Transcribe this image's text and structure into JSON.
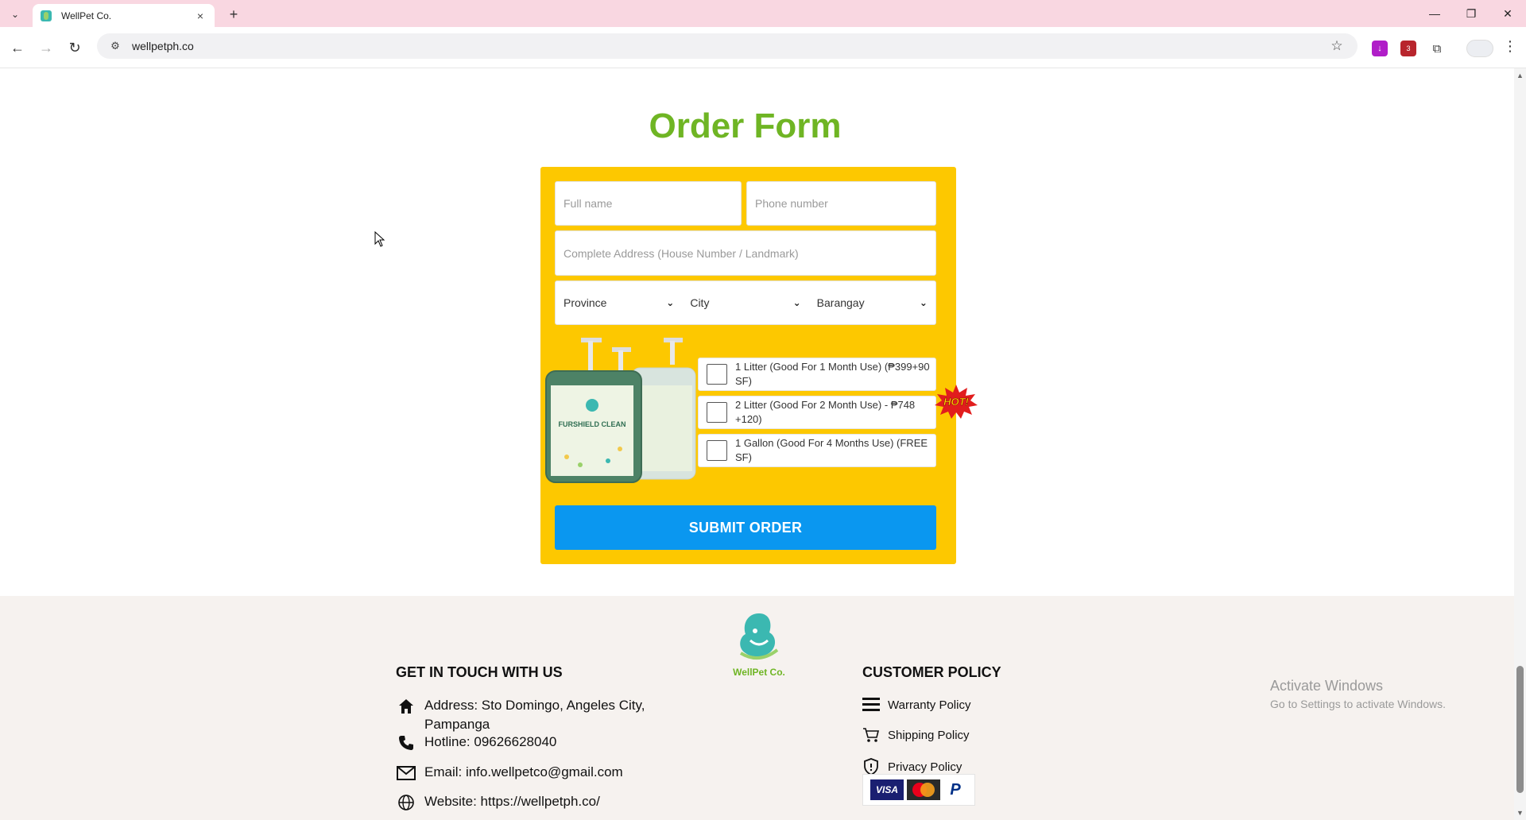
{
  "browser": {
    "tab_title": "WellPet Co.",
    "tab_close": "×",
    "new_tab": "+",
    "url": "wellpetph.co",
    "extension_badge": "3"
  },
  "order_form": {
    "title": "Order Form",
    "full_name_placeholder": "Full name",
    "phone_placeholder": "Phone number",
    "address_placeholder": "Complete Address (House Number / Landmark)",
    "province_label": "Province",
    "city_label": "City",
    "barangay_label": "Barangay",
    "product_label": "FURSHIELD CLEAN",
    "options": [
      {
        "label": "1 Litter (Good For 1 Month Use) (₱399+90 SF)",
        "checked": false
      },
      {
        "label": "2 Litter (Good For 2 Month Use) - ₱748 +120)",
        "checked": false
      },
      {
        "label": "1 Gallon (Good For 4 Months Use) (FREE SF)",
        "checked": false
      }
    ],
    "hot_badge": "HOT!",
    "submit_label": "SUBMIT ORDER"
  },
  "footer": {
    "logo_text": "WellPet Co.",
    "get_in_touch_heading": "GET IN TOUCH WITH US",
    "address": "Address: Sto Domingo, Angeles City, Pampanga",
    "hotline": "Hotline: 09626628040",
    "email": "Email: info.wellpetco@gmail.com",
    "website": "Website: https://wellpetph.co/",
    "customer_policy_heading": "CUSTOMER POLICY",
    "policies": [
      "Warranty Policy",
      "Shipping Policy",
      "Privacy Policy"
    ],
    "payment_visa": "VISA",
    "payment_paypal": "P"
  },
  "os_overlay": {
    "activate_title": "Activate Windows",
    "activate_sub": "Go to Settings to activate Windows."
  },
  "colors": {
    "title_green": "#6fb524",
    "form_yellow": "#fdc800",
    "submit_blue": "#0a97f0",
    "footer_bg": "#f6f2ef",
    "tabbar_pink": "#f9d7e1"
  }
}
